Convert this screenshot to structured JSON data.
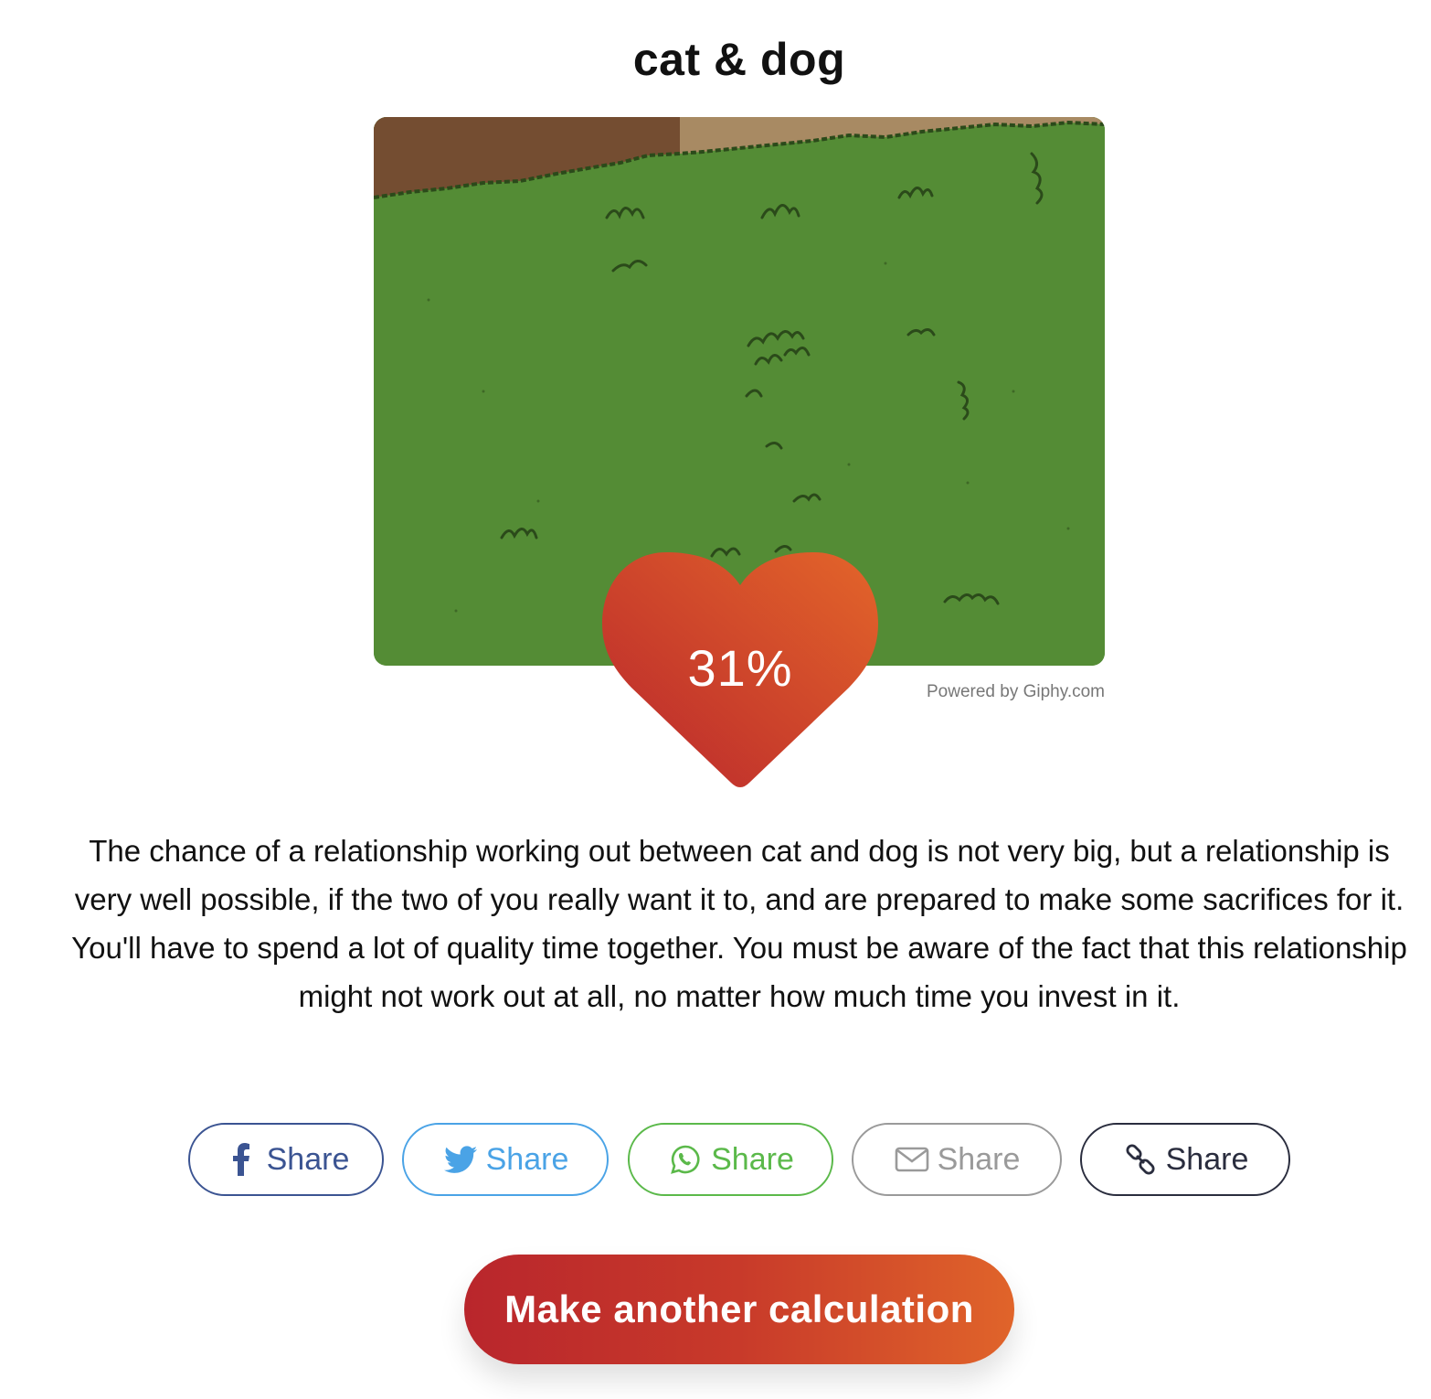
{
  "result": {
    "title": "cat & dog",
    "percentage_text": "31%",
    "percentage": 31,
    "powered_by": "Powered by Giphy.com",
    "description": "The chance of a relationship working out between cat and dog is not very big, but a relationship is very well possible, if the two of you really want it to, and are prepared to make some sacrifices for it. You'll have to spend a lot of quality time together. You must be aware of the fact that this relationship might not work out at all, no matter how much time you invest in it."
  },
  "share": {
    "facebook": {
      "label": "Share",
      "icon": "facebook-icon",
      "color": "#3b5492"
    },
    "twitter": {
      "label": "Share",
      "icon": "twitter-icon",
      "color": "#4aa3e6"
    },
    "whatsapp": {
      "label": "Share",
      "icon": "whatsapp-icon",
      "color": "#5bb94a"
    },
    "email": {
      "label": "Share",
      "icon": "envelope-icon",
      "color": "#9a9a9a"
    },
    "link": {
      "label": "Share",
      "icon": "link-icon",
      "color": "#2a2d3e"
    }
  },
  "cta": {
    "label": "Make another calculation",
    "gradient_start": "#b9262c",
    "gradient_end": "#e0642a"
  },
  "heart": {
    "gradient_start": "#c0302c",
    "gradient_end": "#e0622a"
  }
}
